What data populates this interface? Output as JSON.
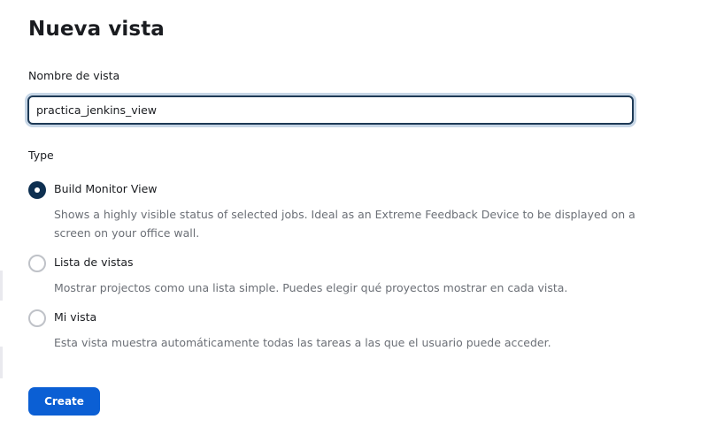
{
  "page": {
    "title": "Nueva vista"
  },
  "name_field": {
    "label": "Nombre de vista",
    "value": "practica_jenkins_view"
  },
  "type_section": {
    "label": "Type",
    "options": [
      {
        "label": "Build Monitor View",
        "description": "Shows a highly visible status of selected jobs. Ideal as an Extreme Feedback Device to be displayed on a screen on your office wall.",
        "selected": true
      },
      {
        "label": "Lista de vistas",
        "description": "Mostrar projectos como una lista simple. Puedes elegir qué proyectos mostrar en cada vista.",
        "selected": false
      },
      {
        "label": "Mi vista",
        "description": "Esta vista muestra automáticamente todas las tareas a las que el usuario puede acceder.",
        "selected": false
      }
    ]
  },
  "actions": {
    "create_label": "Create"
  },
  "colors": {
    "primary_button": "#0b5fd4",
    "radio_selected": "#0e3051",
    "input_focus_border": "#1e3a56",
    "description_text": "#6b6f76"
  }
}
